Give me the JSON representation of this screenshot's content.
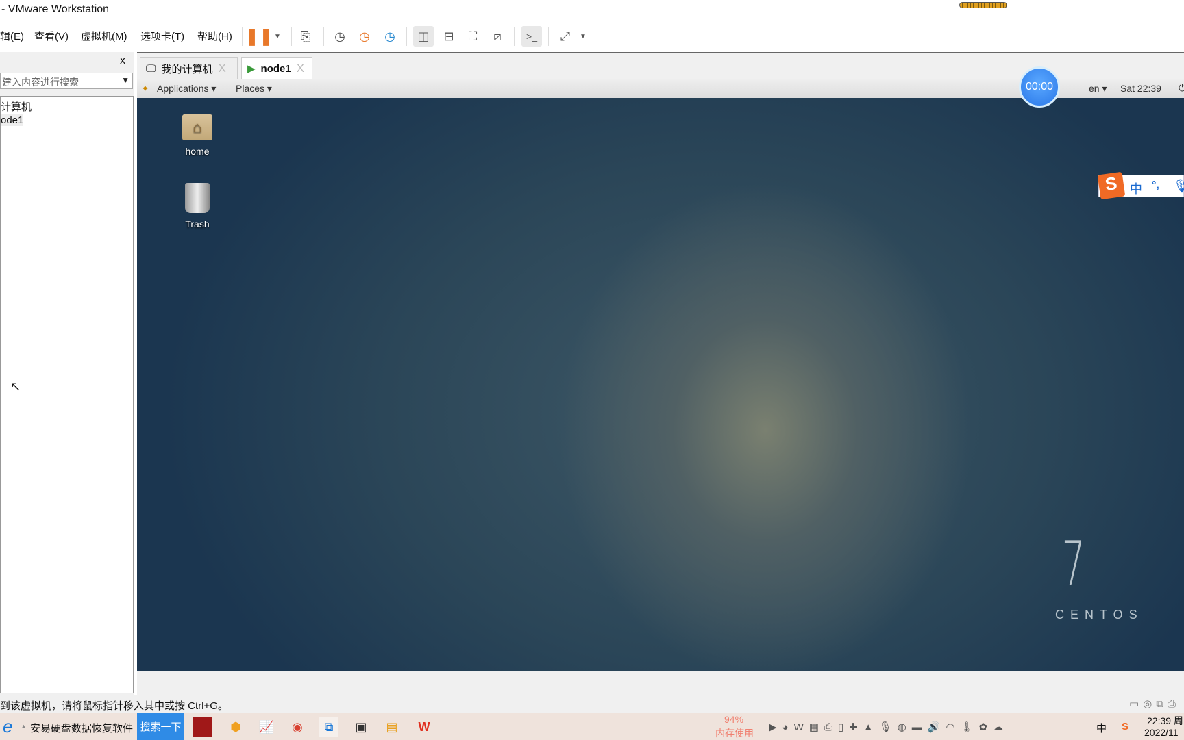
{
  "window": {
    "title": "- VMware Workstation"
  },
  "menu": [
    "辑(E)",
    "查看(V)",
    "虚拟机(M)",
    "选项卡(T)",
    "帮助(H)"
  ],
  "library": {
    "close": "x",
    "search_placeholder": "建入内容进行搜索",
    "items": [
      "计算机",
      "ode1"
    ]
  },
  "tabs": [
    {
      "label": "我的计算机",
      "close": "X"
    },
    {
      "label": "node1",
      "close": "X"
    }
  ],
  "gnome": {
    "applications": "Applications",
    "places": "Places",
    "lang": "en",
    "clock": "Sat 22:39"
  },
  "timer": "00:00",
  "desktop": {
    "icons": [
      "home",
      "Trash"
    ],
    "brand_number": "7",
    "brand": "CENTOS"
  },
  "ime": {
    "mode": "中",
    "punct": "°,"
  },
  "status": {
    "message": "到该虚拟机，请将鼠标指针移入其中或按 Ctrl+G。"
  },
  "taskbar": {
    "app_text": "安易硬盘数据恢复软件",
    "search_button": "搜索一下",
    "memory_percent": "94%",
    "memory_label": "内存使用",
    "ime_tray": "中",
    "time": "22:39 周",
    "date": "2022/11"
  },
  "colors": {
    "pause": "#e8782a",
    "search_button": "#2f8be6",
    "timer": "#3a8cf0",
    "sogou": "#f06a25"
  }
}
